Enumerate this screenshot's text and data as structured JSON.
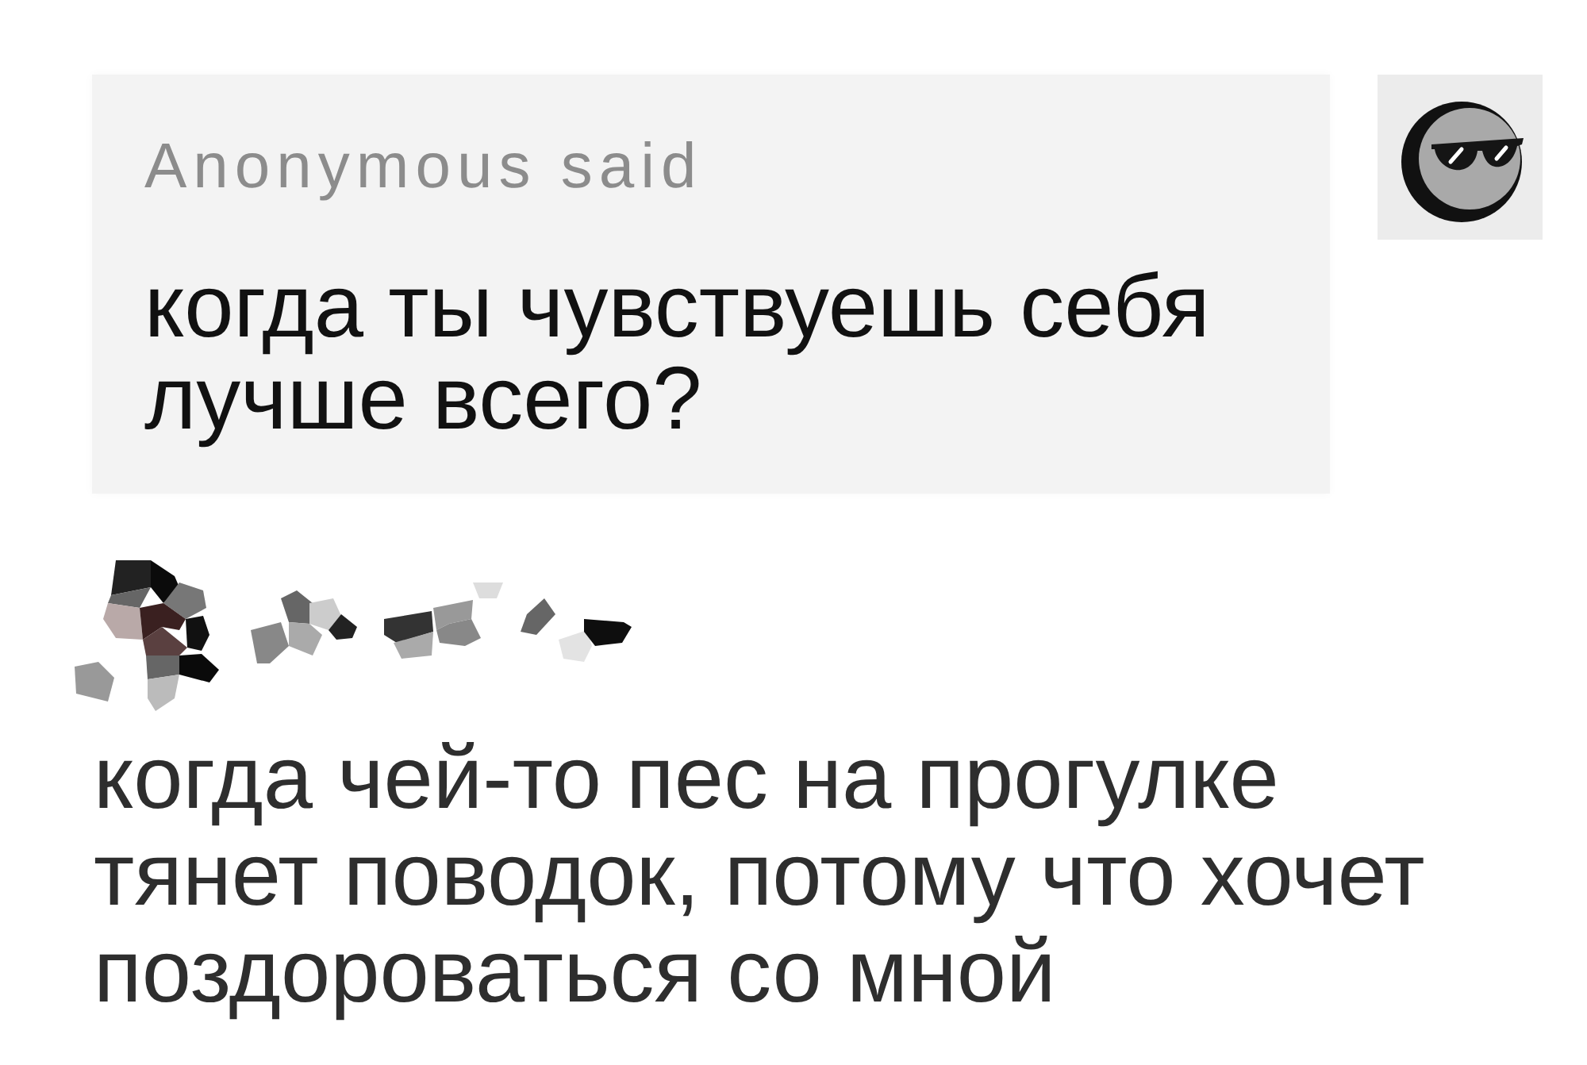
{
  "question_card": {
    "asker_label": "Anonymous said",
    "question": "когда ты чувствуешь себя лучше всего?"
  },
  "answer": {
    "text": "когда чей-то пес на прогулке тянет поводок, потому что хочет поздороваться со мной"
  }
}
